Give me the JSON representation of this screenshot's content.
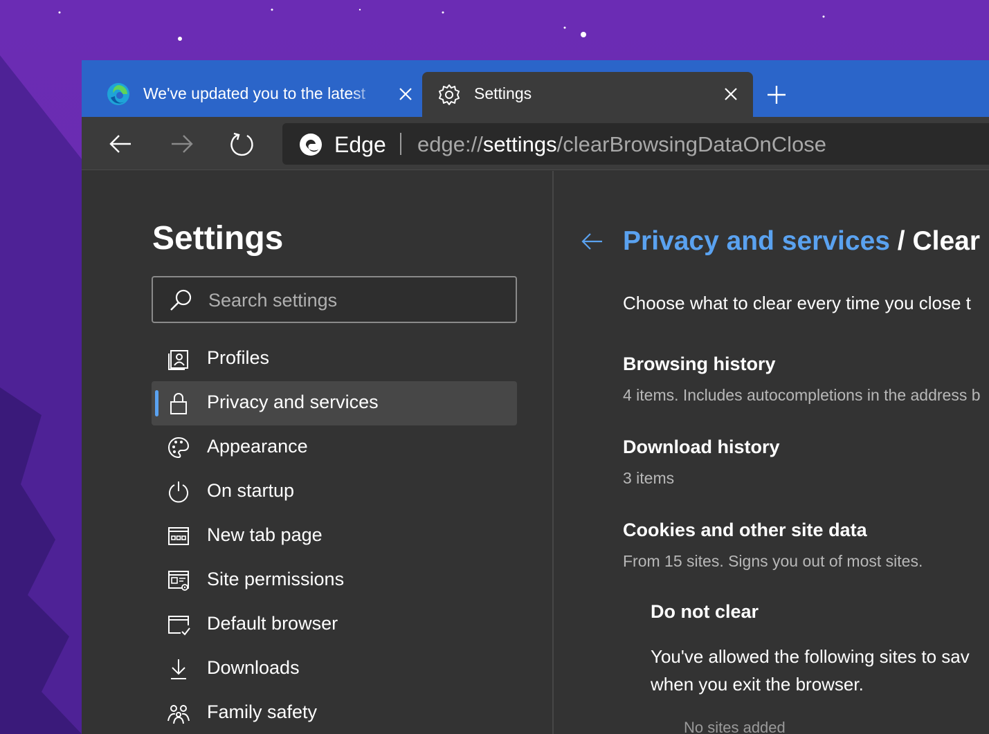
{
  "tabs": [
    {
      "title": "We've updated you to the latest",
      "active": false
    },
    {
      "title": "Settings",
      "active": true
    }
  ],
  "toolbar": {
    "site_label": "Edge",
    "url_prefix": "edge://",
    "url_host": "settings",
    "url_path": "/clearBrowsingDataOnClose"
  },
  "sidebar": {
    "title": "Settings",
    "search_placeholder": "Search settings",
    "items": [
      {
        "label": "Profiles",
        "icon": "profile-icon"
      },
      {
        "label": "Privacy and services",
        "icon": "lock-icon",
        "selected": true
      },
      {
        "label": "Appearance",
        "icon": "palette-icon"
      },
      {
        "label": "On startup",
        "icon": "power-icon"
      },
      {
        "label": "New tab page",
        "icon": "new-tab-icon"
      },
      {
        "label": "Site permissions",
        "icon": "site-permissions-icon"
      },
      {
        "label": "Default browser",
        "icon": "default-browser-icon"
      },
      {
        "label": "Downloads",
        "icon": "download-icon"
      },
      {
        "label": "Family safety",
        "icon": "family-icon"
      }
    ]
  },
  "main": {
    "breadcrumb_parent": "Privacy and services",
    "breadcrumb_current": " / Clear b",
    "intro": "Choose what to clear every time you close t",
    "rows": [
      {
        "title": "Browsing history",
        "subtitle": "4 items. Includes autocompletions in the address b"
      },
      {
        "title": "Download history",
        "subtitle": "3 items"
      },
      {
        "title": "Cookies and other site data",
        "subtitle": "From 15 sites. Signs you out of most sites."
      }
    ],
    "do_not_clear": {
      "title": "Do not clear",
      "description_line1": "You've allowed the following sites to sav",
      "description_line2": "when you exit the browser.",
      "empty_note": "No sites added"
    }
  },
  "colors": {
    "accent": "#5aa2f0",
    "tabstrip": "#2b65c9",
    "panel": "#333333",
    "wallpaper": "#6a2fae"
  }
}
